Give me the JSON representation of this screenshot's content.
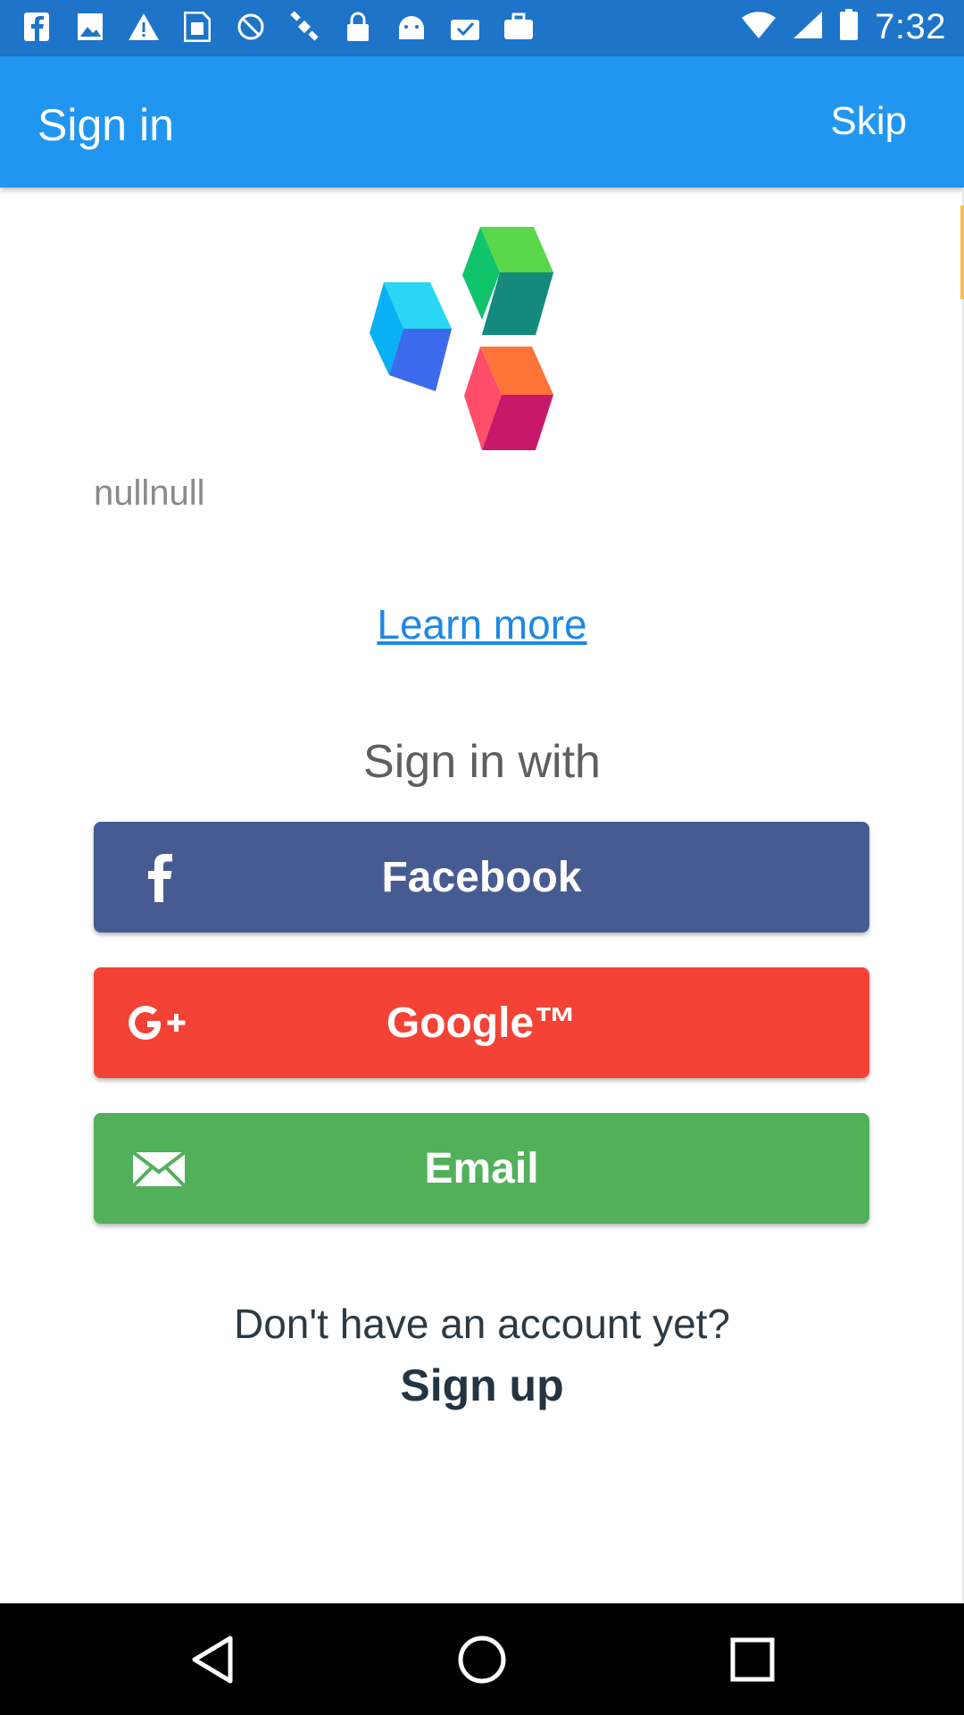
{
  "status_bar": {
    "time": "7:32",
    "icons": [
      "facebook-icon",
      "image-icon",
      "warning-icon",
      "sim-icon",
      "blocked-icon",
      "satellite-icon",
      "lock-icon",
      "android-icon",
      "check-icon",
      "briefcase-icon",
      "wifi-icon",
      "cellular-icon",
      "battery-icon"
    ]
  },
  "app_bar": {
    "title": "Sign in",
    "skip_label": "Skip"
  },
  "main": {
    "null_text": "nullnull",
    "learn_more": "Learn more",
    "sign_in_with": "Sign in with",
    "buttons": {
      "facebook": "Facebook",
      "google": "Google™",
      "email": "Email"
    },
    "no_account": "Don't have an account yet?",
    "sign_up": "Sign up"
  },
  "nav_bar": {
    "icons": [
      "back-icon",
      "home-icon",
      "recents-icon"
    ]
  },
  "colors": {
    "app_bar": "#2196f0",
    "status_bar": "#1e74c8",
    "facebook": "#465b91",
    "google": "#f44336",
    "email": "#52b05a",
    "link": "#1e88e5"
  }
}
